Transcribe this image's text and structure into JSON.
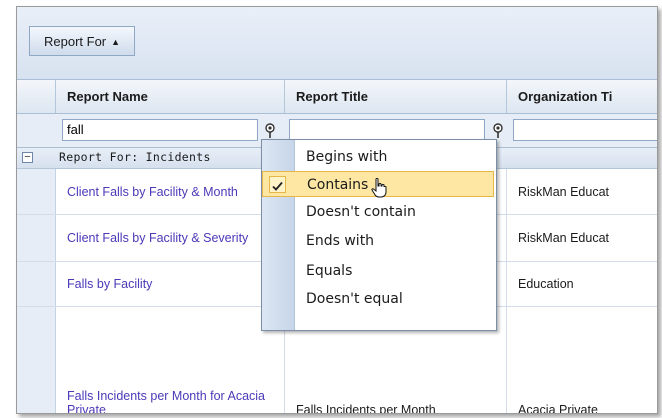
{
  "group_panel": {
    "button_label": "Report For",
    "sort_arrow": "▲"
  },
  "columns": [
    {
      "label": "Report Name"
    },
    {
      "label": "Report Title"
    },
    {
      "label": "Organization Ti"
    }
  ],
  "filters": [
    {
      "value": "fall",
      "icon": "filter-icon"
    },
    {
      "value": "",
      "icon": "filter-icon"
    },
    {
      "value": ""
    }
  ],
  "group": {
    "label": "Report For: Incidents",
    "expander": "−"
  },
  "rows": [
    {
      "name": "Client Falls by Facility & Month",
      "title": "",
      "organization": "RiskMan Educat"
    },
    {
      "name": "Client Falls by Facility & Severity",
      "title": "",
      "organization": "RiskMan Educat"
    },
    {
      "name": "Falls by Facility",
      "title": "",
      "organization": "Education"
    },
    {
      "name": "Falls Incidents per Month for Acacia Private",
      "title": "Falls Incidents per Month",
      "organization": "Acacia Private"
    }
  ],
  "filter_menu": {
    "items": [
      {
        "label": "Begins with",
        "checked": false
      },
      {
        "label": "Contains",
        "checked": true
      },
      {
        "label": "Doesn't contain",
        "checked": false
      },
      {
        "label": "Ends with",
        "checked": false
      },
      {
        "label": "Equals",
        "checked": false
      },
      {
        "label": "Doesn't equal",
        "checked": false
      }
    ]
  },
  "colors": {
    "link": "#4b39b8",
    "header_bg": "#dde6f1",
    "menu_highlight": "#fde7a3"
  }
}
